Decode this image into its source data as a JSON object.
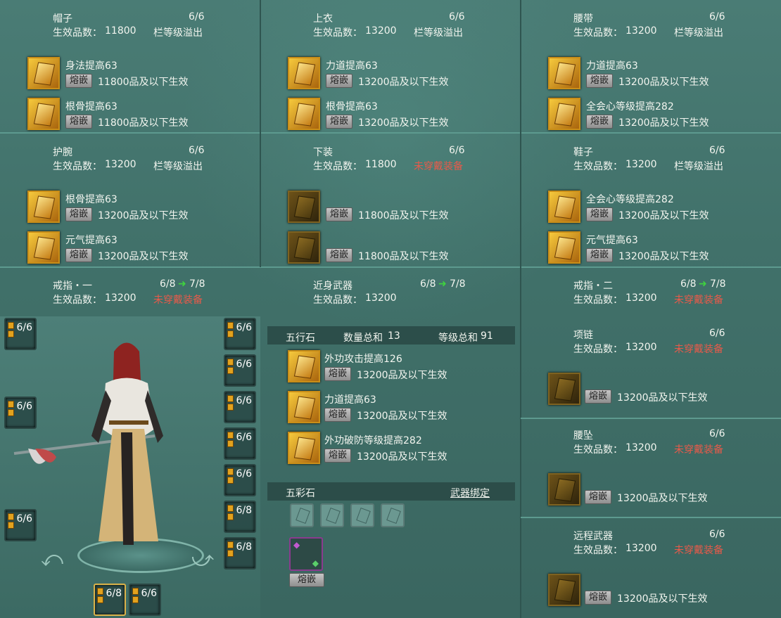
{
  "equipment": [
    {
      "name": "帽子",
      "count": "6/6",
      "pin_label": "生效品数：",
      "pin": "11800",
      "status": "栏等级溢出",
      "status_color": "white",
      "gems": [
        {
          "name": "身法提高63",
          "req": "11800品及以下生效",
          "dark": false
        },
        {
          "name": "根骨提高63",
          "req": "11800品及以下生效",
          "dark": false
        }
      ]
    },
    {
      "name": "上衣",
      "count": "6/6",
      "pin_label": "生效品数：",
      "pin": "13200",
      "status": "栏等级溢出",
      "status_color": "white",
      "gems": [
        {
          "name": "力道提高63",
          "req": "13200品及以下生效",
          "dark": false
        },
        {
          "name": "根骨提高63",
          "req": "13200品及以下生效",
          "dark": false
        }
      ]
    },
    {
      "name": "腰带",
      "count": "6/6",
      "pin_label": "生效品数：",
      "pin": "13200",
      "status": "栏等级溢出",
      "status_color": "white",
      "gems": [
        {
          "name": "力道提高63",
          "req": "13200品及以下生效",
          "dark": false
        },
        {
          "name": "全会心等级提高282",
          "req": "13200品及以下生效",
          "dark": false
        }
      ]
    },
    {
      "name": "护腕",
      "count": "6/6",
      "pin_label": "生效品数：",
      "pin": "13200",
      "status": "栏等级溢出",
      "status_color": "white",
      "gems": [
        {
          "name": "根骨提高63",
          "req": "13200品及以下生效",
          "dark": false
        },
        {
          "name": "元气提高63",
          "req": "13200品及以下生效",
          "dark": false
        }
      ]
    },
    {
      "name": "下装",
      "count": "6/6",
      "pin_label": "生效品数：",
      "pin": "11800",
      "status": "未穿戴装备",
      "status_color": "red",
      "gems": [
        {
          "name": "",
          "req": "11800品及以下生效",
          "dark": true
        },
        {
          "name": "",
          "req": "11800品及以下生效",
          "dark": true
        }
      ]
    },
    {
      "name": "鞋子",
      "count": "6/6",
      "pin_label": "生效品数：",
      "pin": "13200",
      "status": "栏等级溢出",
      "status_color": "white",
      "gems": [
        {
          "name": "全会心等级提高282",
          "req": "13200品及以下生效",
          "dark": false
        },
        {
          "name": "元气提高63",
          "req": "13200品及以下生效",
          "dark": false
        }
      ]
    }
  ],
  "inlay_label": "熔嵌",
  "ring1": {
    "name": "戒指・一",
    "count": "6/8",
    "next": "7/8",
    "pin_label": "生效品数：",
    "pin": "13200",
    "status": "未穿戴装备"
  },
  "melee": {
    "name": "近身武器",
    "count": "6/8",
    "next": "7/8",
    "pin_label": "生效品数：",
    "pin": "13200"
  },
  "ring2": {
    "name": "戒指・二",
    "count": "6/8",
    "next": "7/8",
    "pin_label": "生效品数：",
    "pin": "13200",
    "status": "未穿戴装备"
  },
  "wuxing": {
    "title": "五行石",
    "qty_label": "数量总和",
    "qty": "13",
    "lvl_label": "等级总和",
    "lvl": "91",
    "gems": [
      {
        "name": "外功攻击提高126",
        "req": "13200品及以下生效"
      },
      {
        "name": "力道提高63",
        "req": "13200品及以下生效"
      },
      {
        "name": "外功破防等级提高282",
        "req": "13200品及以下生效"
      }
    ]
  },
  "wucai": {
    "title": "五彩石",
    "bind": "武器绑定"
  },
  "right_items": [
    {
      "name": "项链",
      "count": "6/6",
      "pin_label": "生效品数：",
      "pin": "13200",
      "status": "未穿戴装备",
      "req": "13200品及以下生效"
    },
    {
      "name": "腰坠",
      "count": "6/6",
      "pin_label": "生效品数：",
      "pin": "13200",
      "status": "未穿戴装备",
      "req": "13200品及以下生效"
    },
    {
      "name": "远程武器",
      "count": "6/6",
      "pin_label": "生效品数：",
      "pin": "13200",
      "status": "未穿戴装备",
      "req": "13200品及以下生效"
    }
  ],
  "char_slots": {
    "left": [
      "6/6",
      "6/6",
      "6/6"
    ],
    "right": [
      "6/6",
      "6/6",
      "6/6",
      "6/6",
      "6/6",
      "6/8",
      "6/8"
    ],
    "bottom": [
      "6/8",
      "6/6"
    ]
  },
  "colors": {
    "green": "#3fd23f",
    "red": "#e85a4a",
    "yellow": "#e9d25a",
    "gold": "#c98e18"
  }
}
